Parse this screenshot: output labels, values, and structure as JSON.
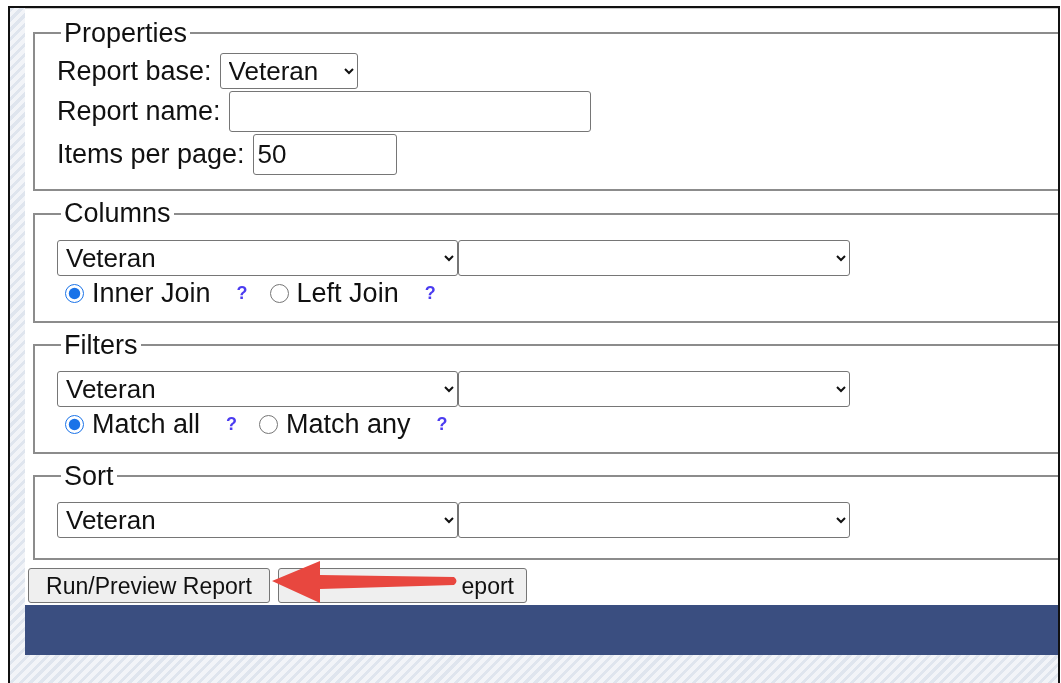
{
  "properties": {
    "legend": "Properties",
    "fields": [
      {
        "kind": "select",
        "label": "Report base:",
        "value": "Veteran"
      },
      {
        "kind": "text",
        "label": "Report name:"
      },
      {
        "kind": "text",
        "label": "Items per page:",
        "value": "50"
      }
    ]
  },
  "sections": [
    {
      "legend": "Columns",
      "field": "Veteran",
      "radios": [
        {
          "label": "Inner Join",
          "selected": true,
          "help": "?"
        },
        {
          "label": "Left Join",
          "selected": false,
          "help": "?"
        }
      ]
    },
    {
      "legend": "Filters",
      "field": "Veteran",
      "radios": [
        {
          "label": "Match all",
          "selected": true,
          "help": "?"
        },
        {
          "label": "Match any",
          "selected": false,
          "help": "?"
        }
      ]
    },
    {
      "legend": "Sort",
      "field": "Veteran"
    }
  ],
  "buttons": [
    {
      "label": "Run/Preview Report"
    },
    {
      "label": "eport"
    }
  ]
}
